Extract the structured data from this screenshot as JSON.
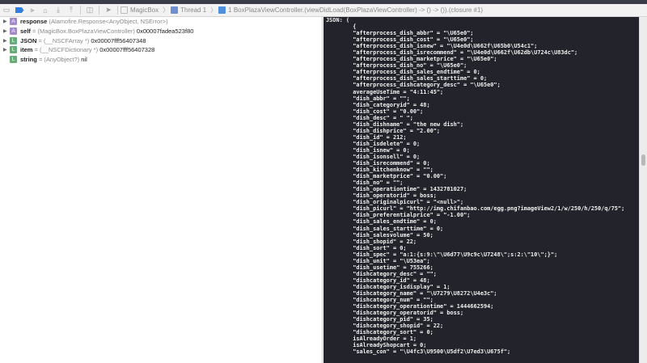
{
  "toolbar": {
    "buttons": [
      "hide-debug-area",
      "breakpoints",
      "continue",
      "step-over",
      "step-into",
      "step-out",
      "view-hierarchy",
      "simulate-location"
    ],
    "breadcrumbs": [
      "MagicBox",
      "Thread 1",
      "1 BoxPlazaViewController.(viewDidLoad(BoxPlazaViewController) -> () -> ()).(closure #1)"
    ]
  },
  "variables": [
    {
      "kind": "A",
      "name": "response",
      "type": "(Alamofire.Response<AnyObject, NSError>)",
      "value": "",
      "expandable": true
    },
    {
      "kind": "A",
      "name": "self",
      "type": "= (MagicBox.BoxPlazaViewController)",
      "value": "0x00007fadea523f80",
      "expandable": true
    },
    {
      "kind": "L",
      "name": "JSON",
      "type": "= (__NSCFArray *)",
      "value": "0x00007fff56407348",
      "expandable": true
    },
    {
      "kind": "L",
      "name": "item",
      "type": "= (__NSCFDictionary *)",
      "value": "0x00007fff56407328",
      "expandable": true
    },
    {
      "kind": "L",
      "name": "string",
      "type": "= (AnyObject?)",
      "value": "nil",
      "expandable": false
    }
  ],
  "console": [
    "JSON: (",
    "        {",
    "        \"afterprocess_dish_abbr\" = \"\\U65e0\";",
    "        \"afterprocess_dish_cost\" = \"\\U65e0\";",
    "        \"afterprocess_dish_isnew\" = \"\\U4e0d\\U662f\\U65b0\\U54c1\";",
    "        \"afterprocess_dish_isrecommend\" = \"\\U4e0d\\U662f\\U62db\\U724c\\U83dc\";",
    "        \"afterprocess_dish_marketprice\" = \"\\U65e0\";",
    "        \"afterprocess_dish_no\" = \"\\U65e0\";",
    "        \"afterprocess_dish_sales_endtime\" = 0;",
    "        \"afterprocess_dish_sales_starttime\" = 0;",
    "        \"afterprocess_dishcategory_desc\" = \"\\U65e0\";",
    "        averageUseTime = \"4:11:45\";",
    "        \"dish_abbr\" = \"\";",
    "        \"dish_categoryid\" = 48;",
    "        \"dish_cost\" = \"0.00\";",
    "        \"dish_desc\" = \" \";",
    "        \"dish_dishname\" = \"the new dish\";",
    "        \"dish_dishprice\" = \"2.00\";",
    "        \"dish_id\" = 212;",
    "        \"dish_isdelete\" = 0;",
    "        \"dish_isnew\" = 0;",
    "        \"dish_isonsell\" = 0;",
    "        \"dish_isrecommend\" = 0;",
    "        \"dish_kitchenknow\" = \"\";",
    "        \"dish_marketprice\" = \"0.00\";",
    "        \"dish_no\" = \"\";",
    "        \"dish_operationtime\" = 1432781027;",
    "        \"dish_operatorid\" = boss;",
    "        \"dish_originalpicurl\" = \"<null>\";",
    "        \"dish_picurl\" = \"http://img.chifanbao.com/egg.png?imageView2/1/w/250/h/250/q/75\";",
    "        \"dish_preferentialprice\" = \"-1.00\";",
    "        \"dish_sales_endtime\" = 0;",
    "        \"dish_sales_starttime\" = 0;",
    "        \"dish_salesvolume\" = 50;",
    "        \"dish_shopid\" = 22;",
    "        \"dish_sort\" = 0;",
    "        \"dish_spec\" = \"a:1:{s:9:\\\"\\U6d77\\U9c9c\\U7248\\\";s:2:\\\"10\\\";}\";",
    "        \"dish_unit\" = \"\\U53ea\";",
    "        \"dish_usetime\" = 755266;",
    "        \"dishcategory_desc\" = \"\";",
    "        \"dishcategory_id\" = 48;",
    "        \"dishcategory_isdisplay\" = 1;",
    "        \"dishcategory_name\" = \"\\U7279\\U8272\\U4e3c\";",
    "        \"dishcategory_num\" = \"\";",
    "        \"dishcategory_operationtime\" = 1444662594;",
    "        \"dishcategory_operatorid\" = boss;",
    "        \"dishcategory_pid\" = 35;",
    "        \"dishcategory_shopid\" = 22;",
    "        \"dishcategory_sort\" = 0;",
    "        isAlreadyOrder = 1;",
    "        isAlreadyShopcart = 0;",
    "        \"sales_con\" = \"\\U4fc3\\U9500\\U5df2\\U7ed3\\U675f\";"
  ]
}
